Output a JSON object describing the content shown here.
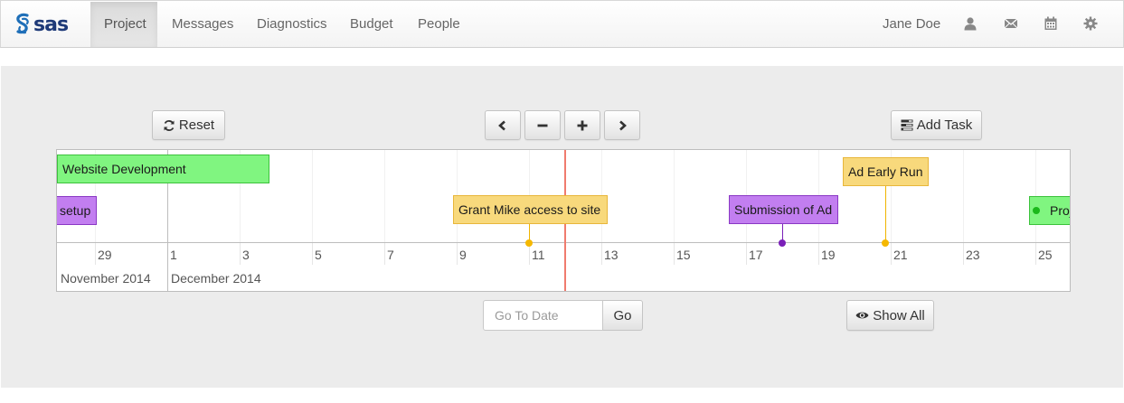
{
  "brand": {
    "logo_text": "sas"
  },
  "nav": {
    "items": [
      {
        "label": "Project",
        "active": true
      },
      {
        "label": "Messages",
        "active": false
      },
      {
        "label": "Diagnostics",
        "active": false
      },
      {
        "label": "Budget",
        "active": false
      },
      {
        "label": "People",
        "active": false
      }
    ],
    "user_name": "Jane Doe",
    "icons": [
      "user-icon",
      "envelope-icon",
      "calendar-icon",
      "gear-icon"
    ]
  },
  "toolbar": {
    "reset_label": "Reset",
    "add_task_label": "Add Task",
    "icons": [
      "refresh-icon",
      "chevron-left-icon",
      "minus-icon",
      "plus-icon",
      "chevron-right-icon",
      "tasks-icon"
    ]
  },
  "timeline": {
    "days": [
      "29",
      "1",
      "3",
      "5",
      "7",
      "9",
      "11",
      "13",
      "15",
      "17",
      "19",
      "21",
      "23",
      "25"
    ],
    "months": [
      "November 2014",
      "December 2014"
    ],
    "items": [
      {
        "label": "Website Development",
        "type": "range",
        "color": "#80f580"
      },
      {
        "label": "setup",
        "type": "range",
        "color": "#c27ef0"
      },
      {
        "label": "Grant Mike access to site",
        "type": "box",
        "color": "#f8d97c"
      },
      {
        "label": "Submission of Ad",
        "type": "box",
        "color": "#c27ef0"
      },
      {
        "label": "Ad Early Run",
        "type": "box",
        "color": "#f8d97c"
      },
      {
        "label": "Proj",
        "type": "point",
        "color": "#80f580"
      }
    ],
    "current_time_color": "#f07b6e"
  },
  "goto": {
    "placeholder": "Go To Date",
    "value": "",
    "button_label": "Go"
  },
  "show_all_label": "Show All"
}
